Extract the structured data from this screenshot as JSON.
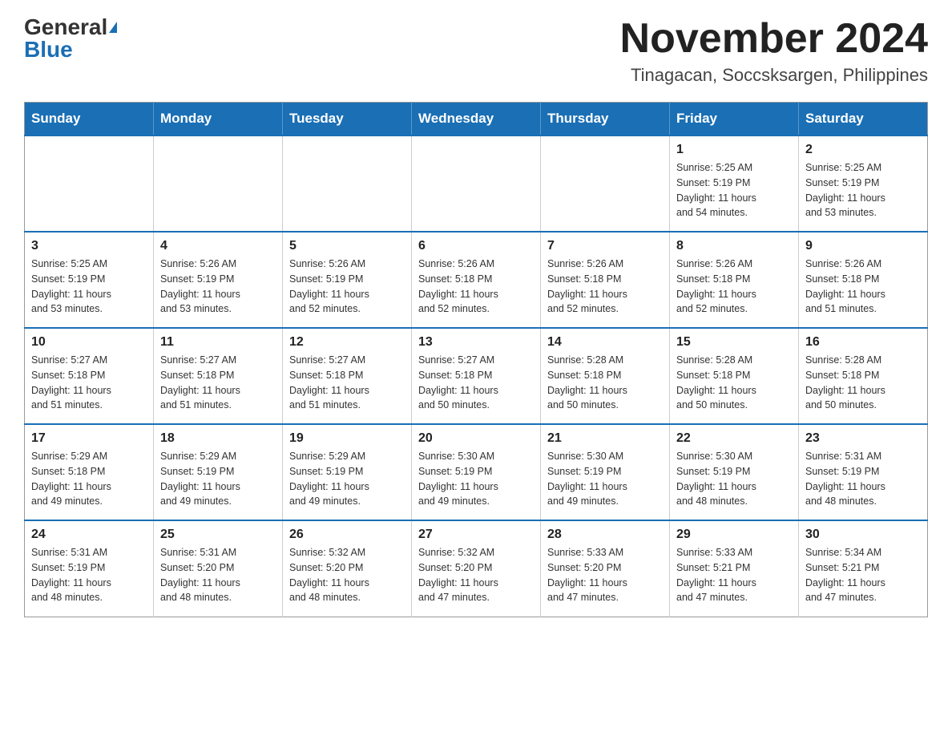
{
  "logo": {
    "general": "General",
    "blue": "Blue"
  },
  "header": {
    "month_title": "November 2024",
    "location": "Tinagacan, Soccsksargen, Philippines"
  },
  "days_of_week": [
    "Sunday",
    "Monday",
    "Tuesday",
    "Wednesday",
    "Thursday",
    "Friday",
    "Saturday"
  ],
  "weeks": [
    [
      {
        "day": "",
        "info": ""
      },
      {
        "day": "",
        "info": ""
      },
      {
        "day": "",
        "info": ""
      },
      {
        "day": "",
        "info": ""
      },
      {
        "day": "",
        "info": ""
      },
      {
        "day": "1",
        "info": "Sunrise: 5:25 AM\nSunset: 5:19 PM\nDaylight: 11 hours\nand 54 minutes."
      },
      {
        "day": "2",
        "info": "Sunrise: 5:25 AM\nSunset: 5:19 PM\nDaylight: 11 hours\nand 53 minutes."
      }
    ],
    [
      {
        "day": "3",
        "info": "Sunrise: 5:25 AM\nSunset: 5:19 PM\nDaylight: 11 hours\nand 53 minutes."
      },
      {
        "day": "4",
        "info": "Sunrise: 5:26 AM\nSunset: 5:19 PM\nDaylight: 11 hours\nand 53 minutes."
      },
      {
        "day": "5",
        "info": "Sunrise: 5:26 AM\nSunset: 5:19 PM\nDaylight: 11 hours\nand 52 minutes."
      },
      {
        "day": "6",
        "info": "Sunrise: 5:26 AM\nSunset: 5:18 PM\nDaylight: 11 hours\nand 52 minutes."
      },
      {
        "day": "7",
        "info": "Sunrise: 5:26 AM\nSunset: 5:18 PM\nDaylight: 11 hours\nand 52 minutes."
      },
      {
        "day": "8",
        "info": "Sunrise: 5:26 AM\nSunset: 5:18 PM\nDaylight: 11 hours\nand 52 minutes."
      },
      {
        "day": "9",
        "info": "Sunrise: 5:26 AM\nSunset: 5:18 PM\nDaylight: 11 hours\nand 51 minutes."
      }
    ],
    [
      {
        "day": "10",
        "info": "Sunrise: 5:27 AM\nSunset: 5:18 PM\nDaylight: 11 hours\nand 51 minutes."
      },
      {
        "day": "11",
        "info": "Sunrise: 5:27 AM\nSunset: 5:18 PM\nDaylight: 11 hours\nand 51 minutes."
      },
      {
        "day": "12",
        "info": "Sunrise: 5:27 AM\nSunset: 5:18 PM\nDaylight: 11 hours\nand 51 minutes."
      },
      {
        "day": "13",
        "info": "Sunrise: 5:27 AM\nSunset: 5:18 PM\nDaylight: 11 hours\nand 50 minutes."
      },
      {
        "day": "14",
        "info": "Sunrise: 5:28 AM\nSunset: 5:18 PM\nDaylight: 11 hours\nand 50 minutes."
      },
      {
        "day": "15",
        "info": "Sunrise: 5:28 AM\nSunset: 5:18 PM\nDaylight: 11 hours\nand 50 minutes."
      },
      {
        "day": "16",
        "info": "Sunrise: 5:28 AM\nSunset: 5:18 PM\nDaylight: 11 hours\nand 50 minutes."
      }
    ],
    [
      {
        "day": "17",
        "info": "Sunrise: 5:29 AM\nSunset: 5:18 PM\nDaylight: 11 hours\nand 49 minutes."
      },
      {
        "day": "18",
        "info": "Sunrise: 5:29 AM\nSunset: 5:19 PM\nDaylight: 11 hours\nand 49 minutes."
      },
      {
        "day": "19",
        "info": "Sunrise: 5:29 AM\nSunset: 5:19 PM\nDaylight: 11 hours\nand 49 minutes."
      },
      {
        "day": "20",
        "info": "Sunrise: 5:30 AM\nSunset: 5:19 PM\nDaylight: 11 hours\nand 49 minutes."
      },
      {
        "day": "21",
        "info": "Sunrise: 5:30 AM\nSunset: 5:19 PM\nDaylight: 11 hours\nand 49 minutes."
      },
      {
        "day": "22",
        "info": "Sunrise: 5:30 AM\nSunset: 5:19 PM\nDaylight: 11 hours\nand 48 minutes."
      },
      {
        "day": "23",
        "info": "Sunrise: 5:31 AM\nSunset: 5:19 PM\nDaylight: 11 hours\nand 48 minutes."
      }
    ],
    [
      {
        "day": "24",
        "info": "Sunrise: 5:31 AM\nSunset: 5:19 PM\nDaylight: 11 hours\nand 48 minutes."
      },
      {
        "day": "25",
        "info": "Sunrise: 5:31 AM\nSunset: 5:20 PM\nDaylight: 11 hours\nand 48 minutes."
      },
      {
        "day": "26",
        "info": "Sunrise: 5:32 AM\nSunset: 5:20 PM\nDaylight: 11 hours\nand 48 minutes."
      },
      {
        "day": "27",
        "info": "Sunrise: 5:32 AM\nSunset: 5:20 PM\nDaylight: 11 hours\nand 47 minutes."
      },
      {
        "day": "28",
        "info": "Sunrise: 5:33 AM\nSunset: 5:20 PM\nDaylight: 11 hours\nand 47 minutes."
      },
      {
        "day": "29",
        "info": "Sunrise: 5:33 AM\nSunset: 5:21 PM\nDaylight: 11 hours\nand 47 minutes."
      },
      {
        "day": "30",
        "info": "Sunrise: 5:34 AM\nSunset: 5:21 PM\nDaylight: 11 hours\nand 47 minutes."
      }
    ]
  ]
}
